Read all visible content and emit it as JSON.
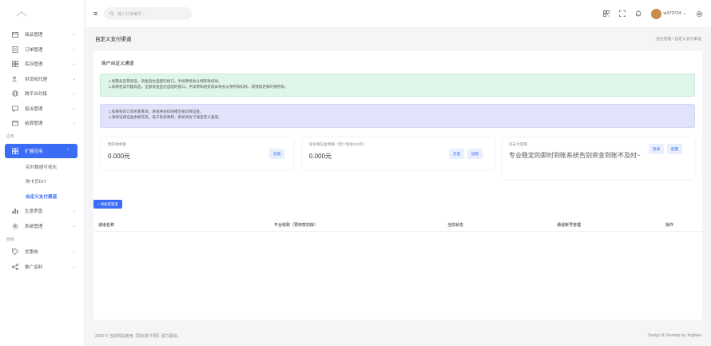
{
  "topbar": {
    "search_placeholder": "输入订单编号...",
    "username": "w370724"
  },
  "sidebar": {
    "items_top": [
      {
        "label": "商品管理",
        "icon": "box-icon"
      },
      {
        "label": "订单管理",
        "icon": "receipt-icon"
      },
      {
        "label": "库存管理",
        "icon": "grid-icon"
      },
      {
        "label": "供货和代理",
        "icon": "users-icon"
      },
      {
        "label": "跨平台对接",
        "icon": "globe-icon"
      },
      {
        "label": "投诉管理",
        "icon": "message-icon"
      },
      {
        "label": "结算管理",
        "icon": "wallet-icon"
      }
    ],
    "section_app": "应用",
    "active": {
      "label": "扩展应用",
      "icon": "grid-icon"
    },
    "subitems": [
      "实时数据可视化",
      "购卡页DIY",
      "自定义支付渠道"
    ],
    "items_mid": [
      {
        "label": "生意罗盘",
        "icon": "chart-icon"
      },
      {
        "label": "系统管理",
        "icon": "gear-icon"
      }
    ],
    "section_marketing": "营销",
    "items_bottom": [
      {
        "label": "优惠券",
        "icon": "tag-icon"
      },
      {
        "label": "推广返利",
        "icon": "share-icon"
      }
    ]
  },
  "page": {
    "title": "自定义支付渠道",
    "breadcrumb": "后台管理 / 自定义支付渠道"
  },
  "card": {
    "title": "商户自定义通道",
    "alert_green_1": "1.如需卖自营商品，资金直达自配的接口，手续费将会从预存款扣除。",
    "alert_green_2": "2.如果售卖代理商品，全部资金直达自配的接口，手续费和进货成本将会从预存款扣除，请预留足够的预存款。",
    "alert_blue_1": "1.如果投诉订单买家胜诉，系统将会扣除相应投诉保证金。",
    "alert_blue_2": "2.请保证保证金余额充足，低于系统限制，系统将会下线自定义通道。",
    "prepaid_label": "预存款余额",
    "prepaid_value": "0.000元",
    "prepaid_btn": "充值",
    "deposit_label": "投诉保证金余额（至少保留100元）",
    "deposit_value": "0.000元",
    "deposit_btn_recharge": "充值",
    "deposit_btn_withdraw": "提取",
    "codepay_label": "码支付官网",
    "codepay_btn_login": "登录",
    "codepay_btn_config": "配置",
    "codepay_desc": "专业稳定的即时到账系统告别资金到账不及时~",
    "add_btn": "+ 添加新渠道",
    "columns": [
      "通道名称",
      "平台收取（预存款扣除）",
      "当前状态",
      "通道账号管理",
      "操作"
    ]
  },
  "footer": {
    "left": "2025 © 当前网站使用【同创发卡网】强力驱动。",
    "right": "Design & Develop by Jingfaka"
  },
  "colors": {
    "accent": "#3b6cf6",
    "alert_green": "#dff5ea",
    "alert_blue": "#e1e3fb"
  }
}
